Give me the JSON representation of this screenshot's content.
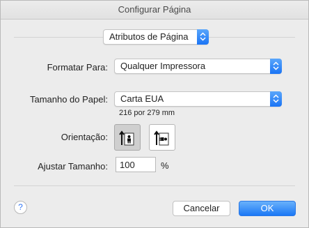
{
  "window": {
    "title": "Configurar Página"
  },
  "settings_popup": {
    "value": "Atributos de Página"
  },
  "format_for": {
    "label": "Formatar Para:",
    "value": "Qualquer Impressora"
  },
  "paper_size": {
    "label": "Tamanho do Papel:",
    "value": "Carta EUA",
    "dimensions": "216 por 279 mm"
  },
  "orientation": {
    "label": "Orientação:",
    "options": [
      {
        "name": "portrait",
        "selected": true
      },
      {
        "name": "landscape",
        "selected": false
      }
    ]
  },
  "scale": {
    "label": "Ajustar Tamanho:",
    "value": "100",
    "unit": "%"
  },
  "buttons": {
    "help": "?",
    "cancel": "Cancelar",
    "ok": "OK"
  },
  "colors": {
    "accent": "#1a74f5",
    "background": "#ececec"
  }
}
